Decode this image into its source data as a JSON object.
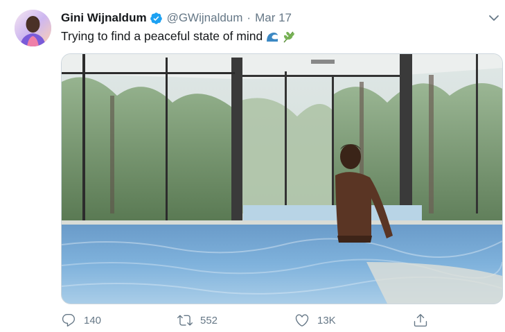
{
  "tweet": {
    "author_name": "Gini Wijnaldum",
    "handle": "@GWijnaldum",
    "separator": "·",
    "date": "Mar 17",
    "text": "Trying to find a peaceful state of mind",
    "emojis": [
      "water-wave-emoji",
      "herb-emoji"
    ],
    "verified": true
  },
  "actions": {
    "replies": "140",
    "retweets": "552",
    "likes": "13K"
  },
  "colors": {
    "text_primary": "#14171a",
    "text_secondary": "#657786",
    "verified_blue": "#1da1f2"
  },
  "icons": [
    "avatar",
    "verified-badge-icon",
    "chevron-down-icon",
    "reply-icon",
    "retweet-icon",
    "like-icon",
    "share-icon"
  ]
}
